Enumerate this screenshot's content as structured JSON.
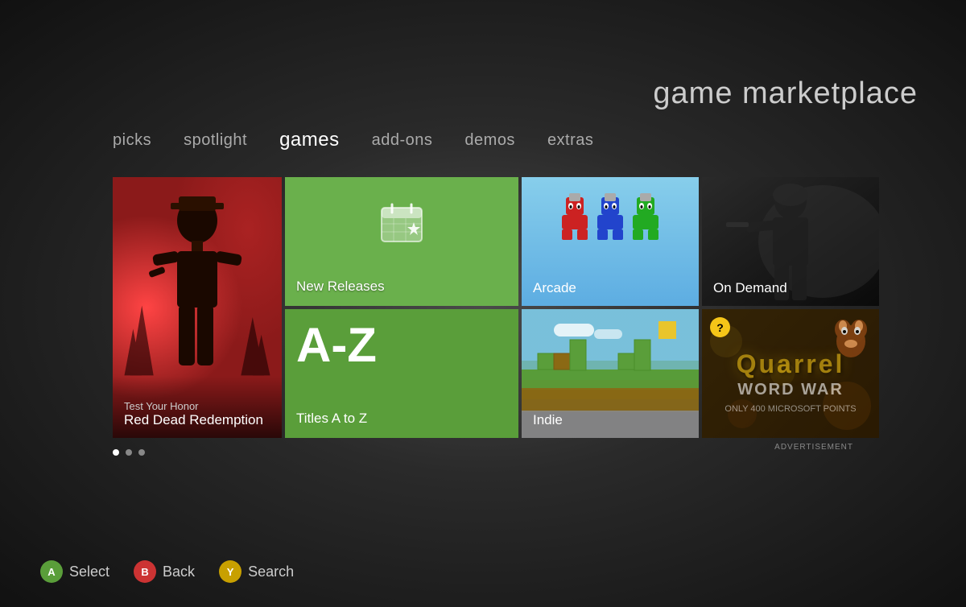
{
  "page": {
    "title": "game marketplace"
  },
  "nav": {
    "tabs": [
      {
        "id": "picks",
        "label": "picks",
        "active": false
      },
      {
        "id": "spotlight",
        "label": "spotlight",
        "active": false
      },
      {
        "id": "games",
        "label": "games",
        "active": true
      },
      {
        "id": "add-ons",
        "label": "add-ons",
        "active": false
      },
      {
        "id": "demos",
        "label": "demos",
        "active": false
      },
      {
        "id": "extras",
        "label": "extras",
        "active": false
      }
    ]
  },
  "tiles": {
    "new_releases": {
      "label": "New Releases"
    },
    "az": {
      "big_letter": "A-Z",
      "label": "Titles A to Z"
    },
    "rdr": {
      "sub": "Test Your Honor",
      "title": "Red Dead Redemption"
    },
    "arcade": {
      "label": "Arcade"
    },
    "on_demand": {
      "label": "On Demand"
    },
    "indie": {
      "label": "Indie"
    },
    "quarrel": {
      "title": "Quarrel",
      "subtitle": "WORD WAR",
      "price": "ONLY 400 MICROSOFT POINTS",
      "icon": "?"
    }
  },
  "advertisement": "ADVERTISEMENT",
  "pagination": {
    "dots": [
      {
        "active": true
      },
      {
        "active": false
      },
      {
        "active": false
      }
    ]
  },
  "controls": {
    "select": {
      "button": "A",
      "label": "Select"
    },
    "back": {
      "button": "B",
      "label": "Back"
    },
    "search": {
      "button": "Y",
      "label": "Search"
    }
  }
}
